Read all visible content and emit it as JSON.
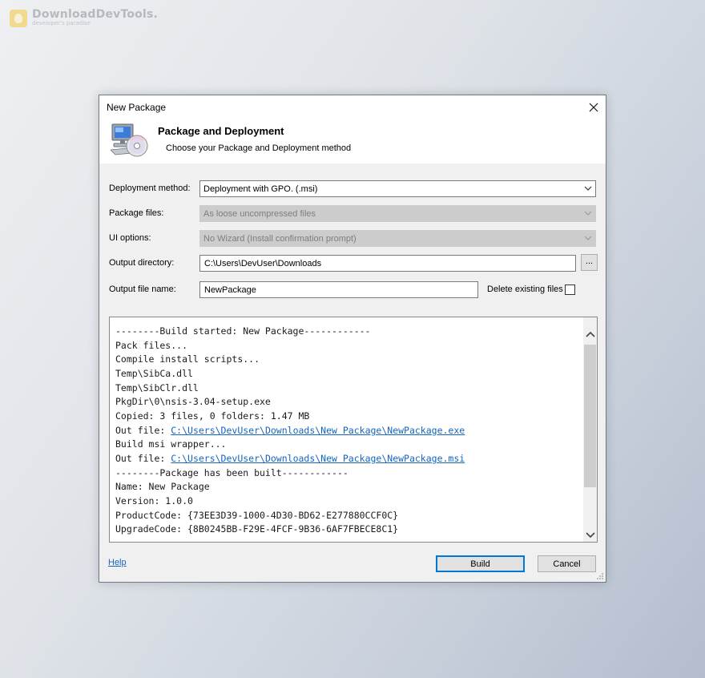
{
  "watermark": {
    "title": "DownloadDevTools.",
    "subtitle": "developer's paradise"
  },
  "window": {
    "title": "New Package"
  },
  "header": {
    "title": "Package and Deployment",
    "subtitle": "Choose your Package and Deployment method"
  },
  "form": {
    "deployment_method": {
      "label": "Deployment method:",
      "value": "Deployment with GPO. (.msi)"
    },
    "package_files": {
      "label": "Package files:",
      "value": "As loose uncompressed files"
    },
    "ui_options": {
      "label": "UI options:",
      "value": "No Wizard (Install confirmation prompt)"
    },
    "output_directory": {
      "label": "Output directory:",
      "value": "C:\\Users\\DevUser\\Downloads",
      "browse_label": "..."
    },
    "output_file_name": {
      "label": "Output file name:",
      "value": "NewPackage"
    },
    "delete_existing": {
      "label": "Delete existing files",
      "checked": false
    }
  },
  "log": {
    "lines": [
      "--------Build started: New Package------------",
      "Pack files...",
      "Compile install scripts...",
      "Temp\\SibCa.dll",
      "Temp\\SibClr.dll",
      "PkgDir\\0\\nsis-3.04-setup.exe",
      "Copied: 3 files, 0 folders: 1.47 MB",
      {
        "prefix": "Out file: ",
        "link": "C:\\Users\\DevUser\\Downloads\\New Package\\NewPackage.exe"
      },
      "Build msi wrapper...",
      {
        "prefix": "Out file: ",
        "link": "C:\\Users\\DevUser\\Downloads\\New Package\\NewPackage.msi"
      },
      "--------Package has been built------------",
      "Name: New Package",
      "Version: 1.0.0",
      "ProductCode: {73EE3D39-1000-4D30-BD62-E277880CCF0C}",
      "UpgradeCode: {8B0245BB-F29E-4FCF-9B36-6AF7FBECE8C1}",
      "-------------------------------------------"
    ]
  },
  "footer": {
    "help_label": "Help",
    "build_label": "Build",
    "cancel_label": "Cancel"
  }
}
